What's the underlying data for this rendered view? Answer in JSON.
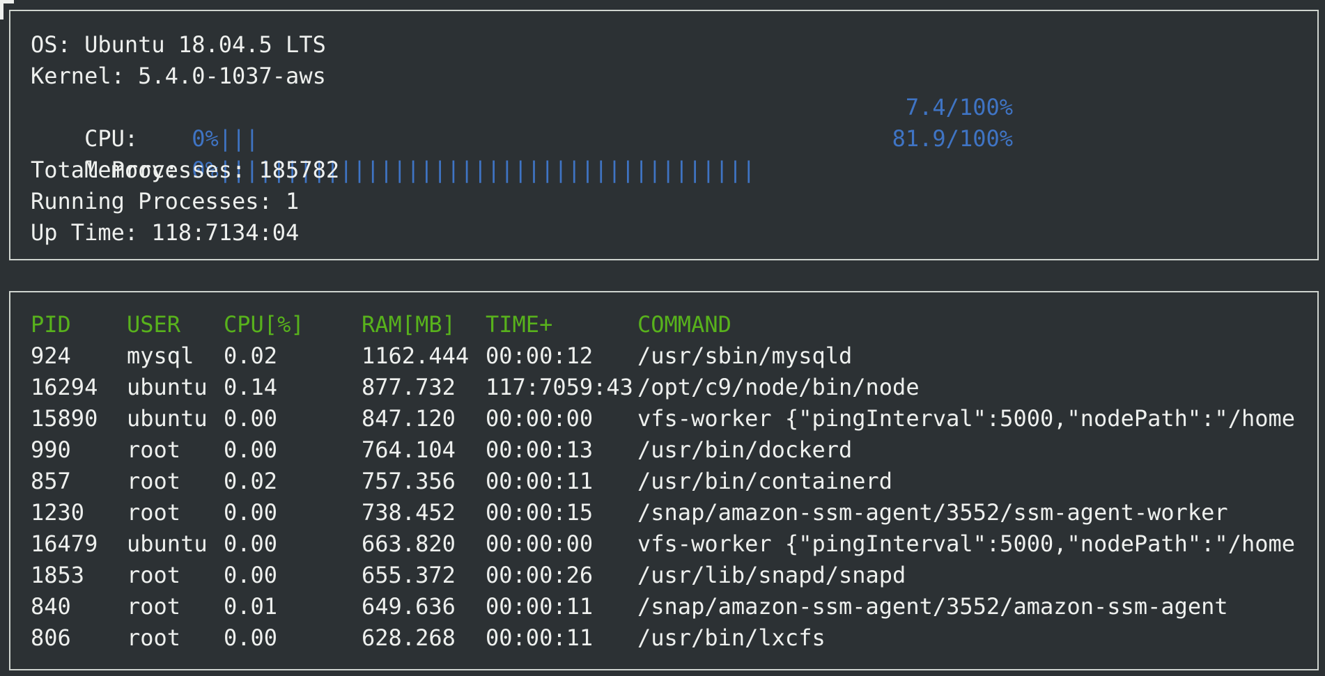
{
  "system": {
    "os_label": "OS: ",
    "os_value": "Ubuntu 18.04.5 LTS",
    "kernel_label": "Kernel: ",
    "kernel_value": "5.4.0-1037-aws",
    "cpu_label": "CPU:    ",
    "cpu_bar": "0%|||",
    "cpu_value": "7.4/100%",
    "cpu_utilization_percent": 7.4,
    "memory_label": "Memory: ",
    "memory_bar": "0%||||||||||||||||||||||||||||||||||||||||",
    "memory_value": "81.9/100%",
    "memory_utilization_percent": 81.9,
    "total_processes_label": "Total Processes: ",
    "total_processes_value": "185782",
    "running_processes_label": "Running Processes: ",
    "running_processes_value": "1",
    "uptime_label": "Up Time: ",
    "uptime_value": "118:7134:04"
  },
  "process_table": {
    "headers": {
      "pid": "PID",
      "user": "USER",
      "cpu": "CPU[%]",
      "ram": "RAM[MB]",
      "time": "TIME+",
      "command": "COMMAND"
    },
    "rows": [
      {
        "pid": "924",
        "user": "mysql",
        "cpu": "0.02",
        "ram": "1162.444",
        "time": "00:00:12",
        "command": "/usr/sbin/mysqld"
      },
      {
        "pid": "16294",
        "user": "ubuntu",
        "cpu": "0.14",
        "ram": "877.732",
        "time": "117:7059:43",
        "command": "/opt/c9/node/bin/node"
      },
      {
        "pid": "15890",
        "user": "ubuntu",
        "cpu": "0.00",
        "ram": "847.120",
        "time": "00:00:00",
        "command": "vfs-worker {\"pingInterval\":5000,\"nodePath\":\"/home"
      },
      {
        "pid": "990",
        "user": "root",
        "cpu": "0.00",
        "ram": "764.104",
        "time": "00:00:13",
        "command": "/usr/bin/dockerd"
      },
      {
        "pid": "857",
        "user": "root",
        "cpu": "0.02",
        "ram": "757.356",
        "time": "00:00:11",
        "command": "/usr/bin/containerd"
      },
      {
        "pid": "1230",
        "user": "root",
        "cpu": "0.00",
        "ram": "738.452",
        "time": "00:00:15",
        "command": "/snap/amazon-ssm-agent/3552/ssm-agent-worker"
      },
      {
        "pid": "16479",
        "user": "ubuntu",
        "cpu": "0.00",
        "ram": "663.820",
        "time": "00:00:00",
        "command": "vfs-worker {\"pingInterval\":5000,\"nodePath\":\"/home"
      },
      {
        "pid": "1853",
        "user": "root",
        "cpu": "0.00",
        "ram": "655.372",
        "time": "00:00:26",
        "command": "/usr/lib/snapd/snapd"
      },
      {
        "pid": "840",
        "user": "root",
        "cpu": "0.01",
        "ram": "649.636",
        "time": "00:00:11",
        "command": "/snap/amazon-ssm-agent/3552/amazon-ssm-agent"
      },
      {
        "pid": "806",
        "user": "root",
        "cpu": "0.00",
        "ram": "628.268",
        "time": "00:00:11",
        "command": "/usr/bin/lxcfs"
      }
    ]
  },
  "colors": {
    "background": "#2c3134",
    "text": "#eef0ee",
    "bar_blue": "#3f74c4",
    "header_green": "#58b21c",
    "border": "#cfd4cf"
  }
}
